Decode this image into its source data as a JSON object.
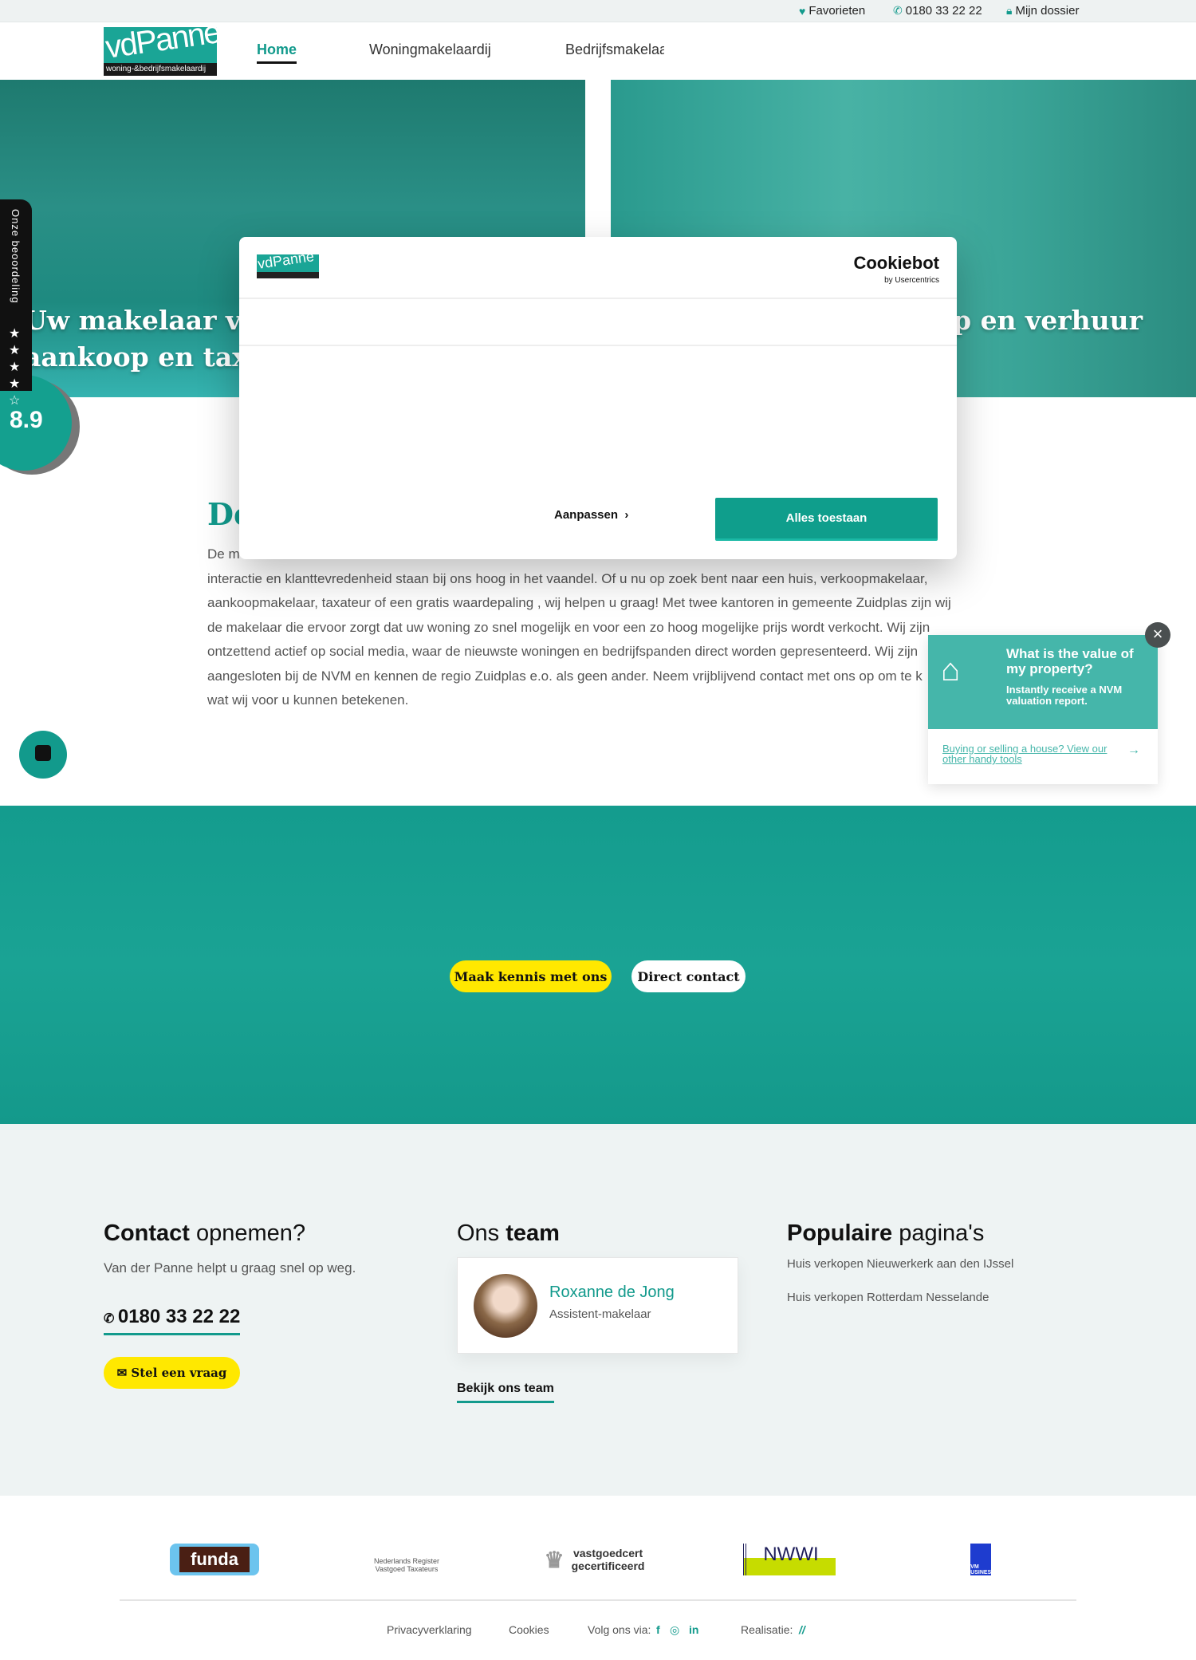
{
  "topbar": {
    "favorites": "Favorieten",
    "phone": "0180 33 22 22",
    "dossier": "Mijn dossier"
  },
  "nav": {
    "logo_text": "vdPanne",
    "logo_sub": "woning-&bedrijfsmakelaardij",
    "items": [
      {
        "label": "Home",
        "active": true
      },
      {
        "label": "Woningmakelaardij"
      },
      {
        "label": "Bedrijfsmakelaa"
      }
    ]
  },
  "hero": {
    "left_line1": "Uw makelaar voo",
    "left_line2": "aankoop en taxat",
    "right_line": "p en verhuur"
  },
  "rating": {
    "label": "Onze beoordeling",
    "stars": 4.5,
    "score": "8.9"
  },
  "intro": {
    "heading": "De",
    "lines": [
      "De m",
      "interactie en klanttevredenheid staan bij ons hoog in het vaandel. Of u nu op zoek bent naar een huis, verkoopmakelaar,",
      "aankoopmakelaar, taxateur of een gratis waardepaling , wij helpen u graag! Met twee kantoren in gemeente Zuidplas zijn wij",
      "de makelaar die ervoor zorgt dat uw woning zo snel mogelijk en voor een zo hoog mogelijke prijs wordt verkocht. Wij zijn",
      "ontzettend actief op social media, waar de nieuwste woningen en bedrijfspanden direct worden gepresenteerd. Wij zijn",
      "aangesloten bij de NVM en kennen de regio Zuidplas e.o. als geen ander. Neem vrijblijvend contact met ons op om te k",
      "wat wij voor u kunnen betekenen."
    ]
  },
  "cookie_modal": {
    "logo_text": "vdPanne",
    "brand": "Cookiebot",
    "brand_sub": "by Usercentrics",
    "customize": "Aanpassen",
    "allow_all": "Alles toestaan"
  },
  "valuation_widget": {
    "title": "What is the value of my property?",
    "subtitle": "Instantly receive a NVM valuation report.",
    "link": "Buying or selling a house? View our other handy tools"
  },
  "cta": {
    "primary": "Maak kennis met ons",
    "secondary": "Direct contact"
  },
  "contact": {
    "title_bold": "Contact",
    "title_rest": " opnemen?",
    "text": "Van der Panne helpt u graag snel op weg.",
    "phone": "0180 33 22 22",
    "ask": "Stel een vraag"
  },
  "team": {
    "title_rest": "Ons ",
    "title_bold": "team",
    "member_name": "Roxanne de Jong",
    "member_role": "Assistent-makelaar",
    "link": "Bekijk ons team"
  },
  "popular": {
    "title_bold": "Populaire",
    "title_rest": " pagina's",
    "links": [
      "Huis verkopen Nieuwerkerk aan den IJssel",
      "Huis verkopen Rotterdam Nesselande"
    ]
  },
  "partners": {
    "funda": "funda",
    "nrvt": "Nederlands Register Vastgoed Taxateurs",
    "vastgoedcert": "vastgoedcert gecertificeerd",
    "nwwi": "NWWI",
    "nvm": "NVM BUSINESS"
  },
  "footer": {
    "privacy": "Privacyverklaring",
    "cookies": "Cookies",
    "follow": "Volg ons via:",
    "realisatie": "Realisatie:"
  },
  "colors": {
    "brand": "#129a8c",
    "yellow": "#ffe800"
  }
}
